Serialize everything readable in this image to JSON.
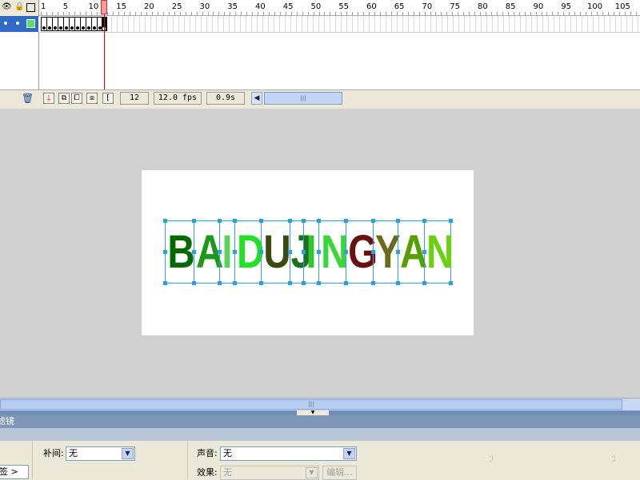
{
  "timeline": {
    "ruler_numbers": [
      "1",
      "5",
      "10",
      "15",
      "20",
      "25",
      "30",
      "35",
      "40",
      "45",
      "50",
      "55",
      "60",
      "65",
      "70",
      "75",
      "80",
      "85",
      "90",
      "95",
      "100",
      "105"
    ],
    "current_frame": "12",
    "fps": "12.0 fps",
    "elapsed": "0.9s"
  },
  "stage": {
    "letters": [
      {
        "char": "B",
        "color": "#006a00"
      },
      {
        "char": "A",
        "color": "#1a9a1a"
      },
      {
        "char": "I",
        "color": "#5ad25a"
      },
      {
        "char": "D",
        "color": "#22e022"
      },
      {
        "char": "U",
        "color": "#3a4a10"
      },
      {
        "char": "J",
        "color": "#1f6f1f"
      },
      {
        "char": "I",
        "color": "#2ec82e"
      },
      {
        "char": "N",
        "color": "#3bd63b"
      },
      {
        "char": "G",
        "color": "#6a1010"
      },
      {
        "char": "Y",
        "color": "#6b6b1a"
      },
      {
        "char": "A",
        "color": "#55a000"
      },
      {
        "char": "N",
        "color": "#6ad010"
      }
    ]
  },
  "panel": {
    "title": "滤镜",
    "tween_label": "补间:",
    "tween_value": "无",
    "sound_label": "声音:",
    "sound_value": "无",
    "effect_label": "效果:",
    "effect_value": "无",
    "edit_button": "编辑...",
    "tag_field": "签 >"
  }
}
